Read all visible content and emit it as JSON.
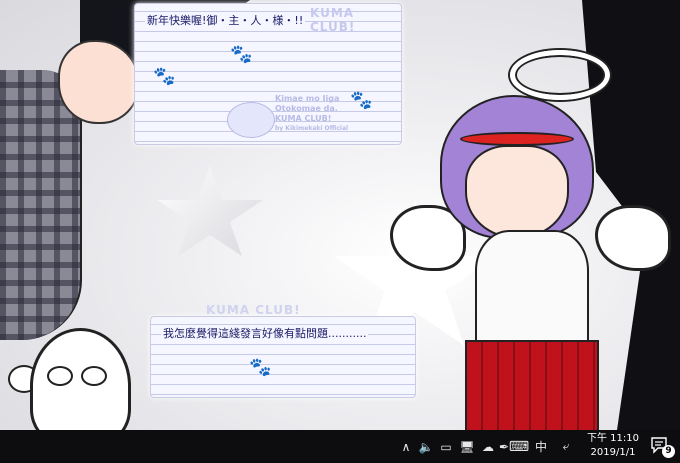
{
  "notes": [
    {
      "text": "新年快樂喔!御・主・人・様・!!",
      "watermark_top": "KUMA CLUB!",
      "side_lines": [
        "Kimae mo Iiga",
        "Otokomae da.",
        "KUMA CLUB!",
        "by Kikimekaki Official"
      ]
    },
    {
      "text": "我怎麼覺得這綫發言好像有點問題...........",
      "watermark_top": "KUMA CLUB!"
    }
  ],
  "taskbar": {
    "tray_icons": [
      {
        "name": "show-hidden-icons",
        "glyph": "∧"
      },
      {
        "name": "volume-icon",
        "glyph": "🔈"
      },
      {
        "name": "battery-icon",
        "glyph": "▭"
      },
      {
        "name": "network-icon",
        "glyph": "🖥"
      },
      {
        "name": "onedrive-icon",
        "glyph": "☁"
      },
      {
        "name": "pen-icon",
        "glyph": "✒"
      },
      {
        "name": "touch-keyboard-icon",
        "glyph": "⌨"
      }
    ],
    "ime_label": "中",
    "ime_mode_glyph": "⤶",
    "time": "下午 11:10",
    "date": "2019/1/1",
    "notification_count": "9"
  }
}
